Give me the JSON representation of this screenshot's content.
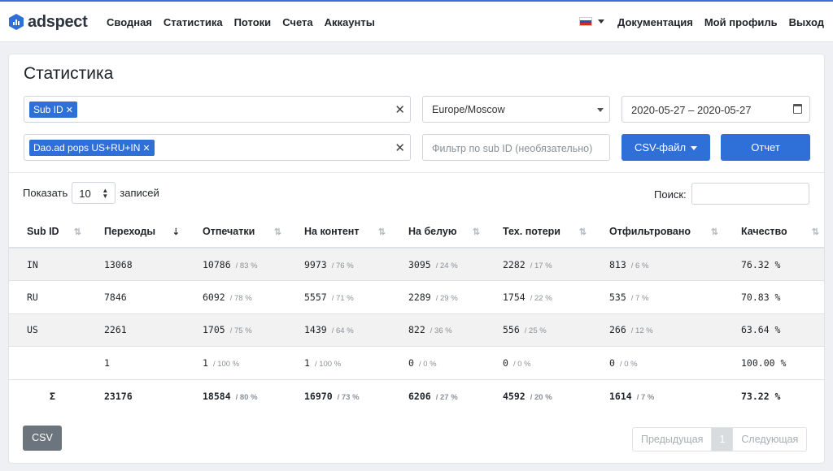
{
  "brand": {
    "name": "adspect",
    "logo_icon": "adspect-logo-icon"
  },
  "nav": {
    "left": [
      "Сводная",
      "Статистика",
      "Потоки",
      "Счета",
      "Аккаунты"
    ],
    "right": [
      "Документация",
      "Мой профиль",
      "Выход"
    ],
    "language_flag": "russia-flag-icon"
  },
  "page": {
    "title": "Статистика"
  },
  "filters": {
    "group_by_tag": "Sub ID",
    "stream_tag": "Dao.ad pops US+RU+IN",
    "timezone": "Europe/Moscow",
    "date_range": "2020-05-27 – 2020-05-27",
    "subid_placeholder": "Фильтр по sub ID (необязательно)",
    "csv_button": "CSV-файл",
    "report_button": "Отчет"
  },
  "table_controls": {
    "show_label": "Показать",
    "page_size": "10",
    "records_label": "записей",
    "search_label": "Поиск:"
  },
  "table": {
    "columns": [
      "Sub ID",
      "Переходы",
      "Отпечатки",
      "На контент",
      "На белую",
      "Тех. потери",
      "Отфильтровано",
      "Качество"
    ],
    "rows": [
      {
        "subid": "IN",
        "clicks": "13068",
        "prints": "10786",
        "prints_pct": "/ 83 %",
        "content": "9973",
        "content_pct": "/ 76 %",
        "white": "3095",
        "white_pct": "/ 24 %",
        "loss": "2282",
        "loss_pct": "/ 17 %",
        "filtered": "813",
        "filtered_pct": "/ 6 %",
        "quality": "76.32 %"
      },
      {
        "subid": "RU",
        "clicks": "7846",
        "prints": "6092",
        "prints_pct": "/ 78 %",
        "content": "5557",
        "content_pct": "/ 71 %",
        "white": "2289",
        "white_pct": "/ 29 %",
        "loss": "1754",
        "loss_pct": "/ 22 %",
        "filtered": "535",
        "filtered_pct": "/ 7 %",
        "quality": "70.83 %"
      },
      {
        "subid": "US",
        "clicks": "2261",
        "prints": "1705",
        "prints_pct": "/ 75 %",
        "content": "1439",
        "content_pct": "/ 64 %",
        "white": "822",
        "white_pct": "/ 36 %",
        "loss": "556",
        "loss_pct": "/ 25 %",
        "filtered": "266",
        "filtered_pct": "/ 12 %",
        "quality": "63.64 %"
      },
      {
        "subid": "",
        "clicks": "1",
        "prints": "1",
        "prints_pct": "/ 100 %",
        "content": "1",
        "content_pct": "/ 100 %",
        "white": "0",
        "white_pct": "/ 0 %",
        "loss": "0",
        "loss_pct": "/ 0 %",
        "filtered": "0",
        "filtered_pct": "/ 0 %",
        "quality": "100.00 %"
      }
    ],
    "total": {
      "subid": "Σ",
      "clicks": "23176",
      "prints": "18584",
      "prints_pct": "/ 80 %",
      "content": "16970",
      "content_pct": "/ 73 %",
      "white": "6206",
      "white_pct": "/ 27 %",
      "loss": "4592",
      "loss_pct": "/ 20 %",
      "filtered": "1614",
      "filtered_pct": "/ 7 %",
      "quality": "73.22 %"
    }
  },
  "footer": {
    "csv_button": "CSV",
    "pagination": {
      "prev": "Предыдущая",
      "current": "1",
      "next": "Следующая"
    }
  },
  "colors": {
    "accent": "#2f6fd8",
    "secondary": "#6c757d"
  }
}
